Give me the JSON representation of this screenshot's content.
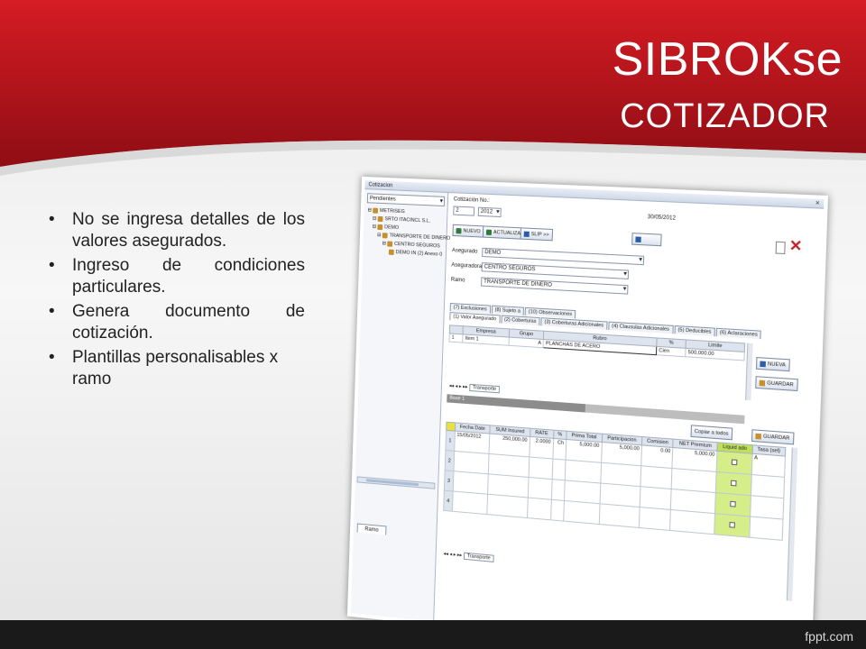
{
  "slide": {
    "title": "SIBROKse",
    "subtitle": "COTIZADOR",
    "watermark": "fppt.com",
    "accent_color": "#b5121b",
    "bullets": [
      "No se ingresa detalles de los valores asegurados.",
      "Ingreso de condiciones particulares.",
      "Genera documento de cotización.",
      "Plantillas personalisables x ramo"
    ]
  },
  "app": {
    "window_title": "Cotizacion",
    "left_pane": {
      "combo": "Pendientes",
      "tree": [
        "METRISEG",
        "SRTO ITACINCL S.L.",
        "DEMO",
        "TRANSPORTE DE DINERO",
        "CENTRO SEGUROS",
        "DEMO IN (2) Anexo 0"
      ],
      "bottom_tab": "Ramo"
    },
    "header": {
      "cotizacion_label": "Cotización No.:",
      "cotizacion_no": "2",
      "year": "2012",
      "date": "30/05/2012"
    },
    "toolbar": {
      "nuevo": "NUEVO",
      "actualiza": "ACTUALIZA",
      "slip": "SLIP >>"
    },
    "fields": {
      "asegurado_label": "Asegurado",
      "asegurado_value": "DEMO",
      "aseguradora_label": "Aseguradora",
      "aseguradora_value": "CENTRO SEGUROS",
      "ramo_label": "Ramo",
      "ramo_value": "TRANSPORTE DE DINERO"
    },
    "tabs_row1": [
      "(7) Exclusiones",
      "(8) Sujeto a",
      "(10) Observaciones"
    ],
    "tabs_row2": [
      "(1) Valor Asegurado",
      "(2) Coberturas",
      "(3) Coberturas Adicionales",
      "(4) Clausulas Adicionales",
      "(5) Deducibles",
      "(6) Aclaraciones"
    ],
    "items_grid": {
      "headers": [
        "",
        "Empresa",
        "Grupo",
        "Rubro",
        "%",
        "Limite"
      ],
      "rows": [
        [
          "1",
          "Item 1",
          "A",
          "PLANCHAS DE ACERO",
          "Cien",
          "500,000.00"
        ]
      ],
      "nueva_button": "NUEVA",
      "guardar_button": "GUARDAR",
      "bottom_tab": "Transporte"
    },
    "base_band": "Base 1",
    "premium_grid": {
      "headers": [
        "",
        "Fecha Date",
        "SUM Insured",
        "RATE",
        "%",
        "Prima Total",
        "Participacion",
        "Comision",
        "NET Premium",
        "Liquid ado",
        "Tasa (sel)"
      ],
      "rows": [
        [
          "1",
          "15/05/2012",
          "250,000.00",
          "2.0000",
          "Ch",
          "5,000.00",
          "5,000.00",
          "0.00",
          "5,000.00",
          "",
          "A"
        ],
        [
          "2",
          "",
          "",
          "",
          "",
          "",
          "",
          "",
          "",
          "",
          ""
        ],
        [
          "3",
          "",
          "",
          "",
          "",
          "",
          "",
          "",
          "",
          "",
          ""
        ],
        [
          "4",
          "",
          "",
          "",
          "",
          "",
          "",
          "",
          "",
          "",
          ""
        ]
      ],
      "copiar_button": "Copiar a todos",
      "guardar_button": "GUARDAR",
      "bottom_tab": "Transporte"
    }
  }
}
